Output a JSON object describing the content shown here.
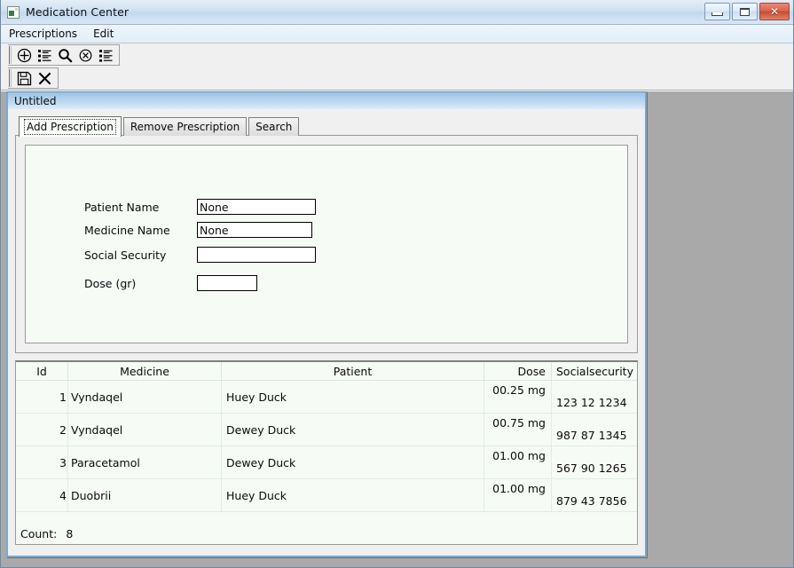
{
  "window": {
    "title": "Medication Center",
    "app_icon": "app-icon",
    "controls": {
      "minimize": "minimize-button",
      "maximize": "maximize-button",
      "close_label": "✕"
    }
  },
  "menu": {
    "items": [
      {
        "label": "Prescriptions"
      },
      {
        "label": "Edit"
      }
    ]
  },
  "toolbars": [
    {
      "name": "prescriptions-toolbar",
      "buttons": [
        {
          "icon": "add-circle-icon"
        },
        {
          "icon": "list-add-icon"
        },
        {
          "icon": "search-icon"
        },
        {
          "icon": "remove-circle-icon"
        },
        {
          "icon": "list-icon"
        }
      ]
    },
    {
      "name": "edit-toolbar",
      "buttons": [
        {
          "icon": "save-icon"
        },
        {
          "icon": "close-x-icon"
        }
      ]
    }
  ],
  "mdi_child": {
    "title": "Untitled",
    "tabs": [
      {
        "label": "Add Prescription",
        "active": true
      },
      {
        "label": "Remove Prescription",
        "active": false
      },
      {
        "label": "Search",
        "active": false
      }
    ],
    "form": {
      "fields": [
        {
          "label": "Patient Name",
          "value": "None",
          "placeholder": ""
        },
        {
          "label": "Medicine Name",
          "value": "None",
          "placeholder": ""
        },
        {
          "label": "Social Security",
          "value": "",
          "placeholder": ""
        },
        {
          "label": "Dose (gr)",
          "value": "",
          "placeholder": ""
        }
      ]
    },
    "table": {
      "headers": [
        "Id",
        "Medicine",
        "Patient",
        "Dose",
        "Socialsecurity"
      ],
      "rows": [
        {
          "id": "1",
          "medicine": "Vyndaqel",
          "patient": "Huey Duck",
          "dose": "00.25 mg",
          "socialsecurity": "123 12 1234"
        },
        {
          "id": "2",
          "medicine": "Vyndaqel",
          "patient": "Dewey Duck",
          "dose": "00.75 mg",
          "socialsecurity": "987 87 1345"
        },
        {
          "id": "3",
          "medicine": "Paracetamol",
          "patient": "Dewey Duck",
          "dose": "01.00 mg",
          "socialsecurity": "567 90 1265"
        },
        {
          "id": "4",
          "medicine": "Duobrii",
          "patient": "Huey Duck",
          "dose": "01.00 mg",
          "socialsecurity": "879 43 7856"
        }
      ],
      "count_label": "Count:",
      "count_value": "8"
    }
  },
  "colors": {
    "titlebar_gradient_top": "#e4eef8",
    "titlebar_gradient_bottom": "#d8e7f6",
    "close_button": "#d9604a",
    "mdi_background": "#a9a9a9",
    "mdi_child_border": "#7aa8d2",
    "panel_background": "#f6fbf6",
    "chrome_background": "#f0f0f0"
  }
}
